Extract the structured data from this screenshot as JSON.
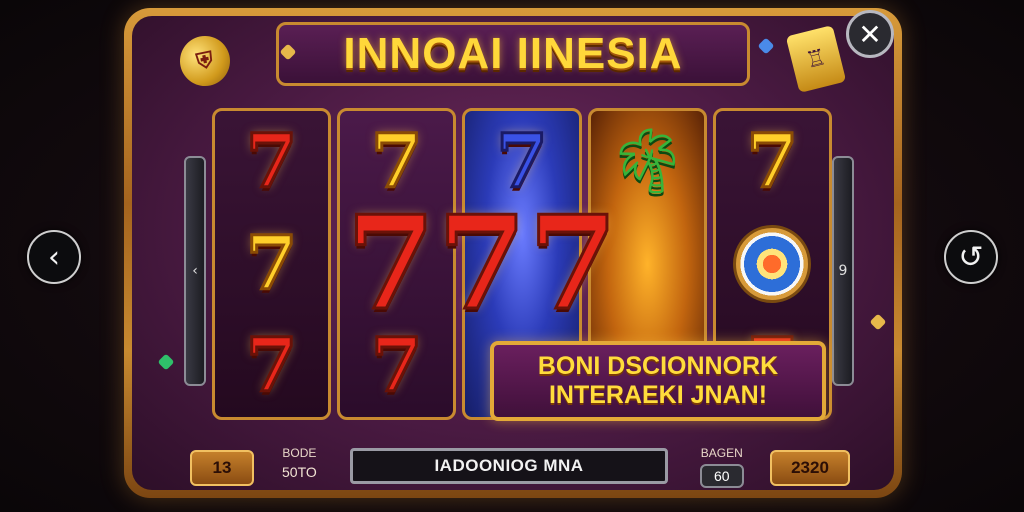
{
  "title": "INNOAI IINESIA",
  "bonus": {
    "line1": "BONI DSCIONNORK",
    "line2": "INTERAEKI JNAN!"
  },
  "bottom": {
    "left_counter": "13",
    "left_label": "BODE",
    "left_value": "50TO",
    "status": "IADOONIOG MNA",
    "right_label": "BAGEN",
    "right_value": "60",
    "right_counter": "2320"
  },
  "side": {
    "left_glyph": "‹",
    "right_glyph": "9"
  },
  "nav": {
    "back_glyph": "‹",
    "refresh_glyph": "↺",
    "close_glyph": "✕"
  },
  "reels": [
    {
      "top": "7",
      "bottom_left": "7",
      "bottom": "7"
    },
    {
      "top": "7",
      "bottom": "7"
    },
    {
      "top": "7"
    },
    {
      "top": "palm-tree"
    },
    {
      "top": "7",
      "mid": "target",
      "bottom": "7"
    }
  ],
  "big_row": [
    "7",
    "7",
    "7"
  ],
  "icons": [
    "back-icon",
    "refresh-icon",
    "close-icon",
    "shield-badge-icon",
    "slot-machine-icon",
    "palm-tree-icon",
    "target-icon"
  ],
  "colors": {
    "frame_gold": "#c88a30",
    "panel_purple": "#4a1a42",
    "title_yellow": "#ffd83a",
    "seven_red": "#e8261a",
    "seven_gold": "#ffcf2a",
    "seven_blue": "#3a52e6"
  }
}
